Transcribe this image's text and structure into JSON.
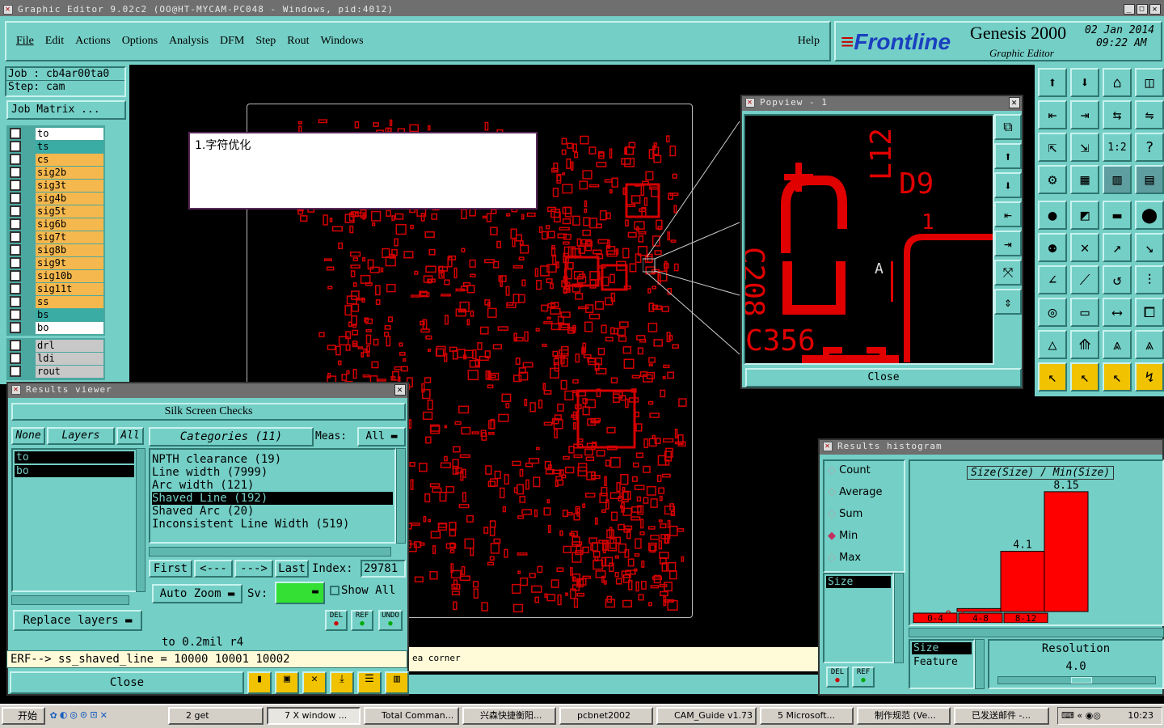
{
  "window_title": "Graphic Editor 9.02c2 (OO@HT-MYCAM-PC048 - Windows, pid:4012)",
  "menu": [
    "File",
    "Edit",
    "Actions",
    "Options",
    "Analysis",
    "DFM",
    "Step",
    "Rout",
    "Windows"
  ],
  "help": "Help",
  "brand": {
    "logo": "Frontline",
    "product": "Genesis 2000",
    "sub": "Graphic Editor",
    "date": "02 Jan 2014",
    "time": "09:22 AM"
  },
  "job": "Job : cb4ar00ta0",
  "step": "Step: cam",
  "job_matrix": "Job Matrix ...",
  "layers": [
    "to",
    "ts",
    "cs",
    "sig2b",
    "sig3t",
    "sig4b",
    "sig5t",
    "sig6b",
    "sig7t",
    "sig8b",
    "sig9t",
    "sig10b",
    "sig11t",
    "ss",
    "bs",
    "bo"
  ],
  "layers2": [
    "drl",
    "ldi",
    "rout"
  ],
  "annotation": "1.字符优化",
  "popview": {
    "title": "Popview - 1",
    "close": "Close",
    "labels": [
      "L12",
      "D9",
      "1",
      "C208",
      "C356",
      "A"
    ]
  },
  "results_viewer": {
    "title": "Results viewer",
    "header": "Silk Screen Checks",
    "none": "None",
    "layers": "Layers",
    "all": "All",
    "categories": "Categories (11)",
    "meas_label": "Meas:",
    "meas_value": "All",
    "layer_items": [
      "to",
      "bo"
    ],
    "items": [
      "NPTH clearance (19)",
      "Line width (7999)",
      "Arc width (121)",
      "Shaved Line (192)",
      "Shaved Arc (20)",
      "Inconsistent Line Width (519)"
    ],
    "first": "First",
    "prev": "<---",
    "next": "--->",
    "last": "Last",
    "index_label": "Index:",
    "index": "29781",
    "auto_zoom": "Auto Zoom",
    "sv": "Sv:",
    "show_all": "Show All",
    "replace": "Replace layers",
    "del": "DEL",
    "ref": "REF",
    "undo": "UNDO",
    "status": "to 0.2mil  r4",
    "close": "Close"
  },
  "erf": "ERF--> ss_shaved_line = 10000 10001 10002",
  "statusbar": "ea corner",
  "histogram": {
    "title": "Results histogram",
    "options": [
      "Count",
      "Average",
      "Sum",
      "Min",
      "Max"
    ],
    "selected": "Min",
    "list": [
      "Size"
    ],
    "graph_title": "Size(Size) / Min(Size)",
    "bars": [
      {
        "label": "0-4",
        "value": 0.2
      },
      {
        "label": "4-8",
        "value": 4.1
      },
      {
        "label": "8-12",
        "value": 8.15
      }
    ],
    "bar_labels": [
      "0.2",
      "4.1",
      "8.15"
    ],
    "x_labels": [
      "0-\n4",
      "4-\n8",
      "8-\n12"
    ],
    "sort": [
      "Size",
      "Feature"
    ],
    "resolution_label": "Resolution",
    "resolution": "4.0",
    "del": "DEL",
    "ref": "REF"
  },
  "taskbar": {
    "start": "开始",
    "items": [
      "2 get",
      "7 X window ...",
      "Total Comman...",
      "兴森快捷衡阳...",
      "pcbnet2002",
      "CAM_Guide v1.73",
      "5 Microsoft...",
      "制作规范 (Ve...",
      "已发送邮件 -..."
    ],
    "clock": "10:23"
  }
}
